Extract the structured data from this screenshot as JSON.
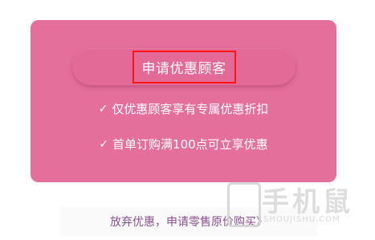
{
  "promo_card": {
    "apply_button_label": "申请优惠顾客",
    "benefits": [
      {
        "check_icon": "✓",
        "text": "仅优惠顾客享有专属优惠折扣"
      },
      {
        "check_icon": "✓",
        "text": "首单订购满100点可立享优惠"
      }
    ]
  },
  "decline_link": "放弃优惠，申请零售原价购买》",
  "watermark": {
    "brand": "手机鼠",
    "site": "SHOUJISHU.COM"
  },
  "colors": {
    "card_background": "#e56f9b",
    "highlight_border": "#ff1414",
    "link_color": "#8a4f90"
  }
}
